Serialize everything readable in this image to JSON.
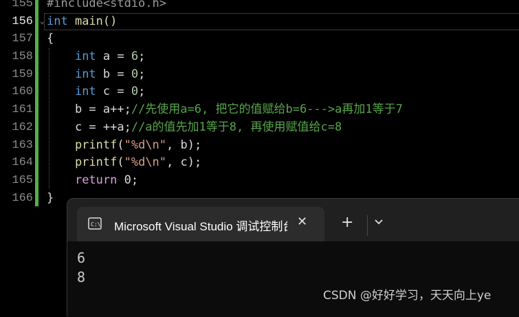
{
  "editor": {
    "line_numbers": [
      "155",
      "156",
      "157",
      "158",
      "159",
      "160",
      "161",
      "162",
      "163",
      "164",
      "165",
      "166"
    ],
    "code": [
      [
        {
          "t": "#include<stdio.h>",
          "c": "pp"
        }
      ],
      [
        {
          "t": "int",
          "c": "kw"
        },
        {
          "t": " main()",
          "c": "fn"
        }
      ],
      [
        {
          "t": "{",
          "c": ""
        }
      ],
      [
        {
          "t": "    ",
          "c": ""
        },
        {
          "t": "int",
          "c": "kw"
        },
        {
          "t": " a = ",
          "c": ""
        },
        {
          "t": "6",
          "c": "num"
        },
        {
          "t": ";",
          "c": ""
        }
      ],
      [
        {
          "t": "    ",
          "c": ""
        },
        {
          "t": "int",
          "c": "kw"
        },
        {
          "t": " b = ",
          "c": ""
        },
        {
          "t": "0",
          "c": "num"
        },
        {
          "t": ";",
          "c": ""
        }
      ],
      [
        {
          "t": "    ",
          "c": ""
        },
        {
          "t": "int",
          "c": "kw"
        },
        {
          "t": " c = ",
          "c": ""
        },
        {
          "t": "0",
          "c": "num"
        },
        {
          "t": ";",
          "c": ""
        }
      ],
      [
        {
          "t": "    b = a++;",
          "c": ""
        },
        {
          "t": "//先使用a=6, 把它的值赋给b=6--->a再加1等于7",
          "c": "cm"
        }
      ],
      [
        {
          "t": "    c = ++a;",
          "c": ""
        },
        {
          "t": "//a的值先加1等于8, 再使用赋值给c=8",
          "c": "cm"
        }
      ],
      [
        {
          "t": "    printf",
          "c": "fn"
        },
        {
          "t": "(",
          "c": ""
        },
        {
          "t": "\"%d\\n\"",
          "c": "str"
        },
        {
          "t": ", b);",
          "c": ""
        }
      ],
      [
        {
          "t": "    printf",
          "c": "fn"
        },
        {
          "t": "(",
          "c": ""
        },
        {
          "t": "\"%d\\n\"",
          "c": "str"
        },
        {
          "t": ", c);",
          "c": ""
        }
      ],
      [
        {
          "t": "    ",
          "c": ""
        },
        {
          "t": "return",
          "c": "ret"
        },
        {
          "t": " 0;",
          "c": ""
        }
      ],
      [
        {
          "t": "}",
          "c": ""
        }
      ]
    ]
  },
  "console": {
    "tab_title": "Microsoft Visual Studio 调试控制台",
    "new_tab": "+",
    "close": "✕",
    "output": [
      "6",
      "8"
    ]
  },
  "watermark": "CSDN @好好学习，天天向上ye"
}
